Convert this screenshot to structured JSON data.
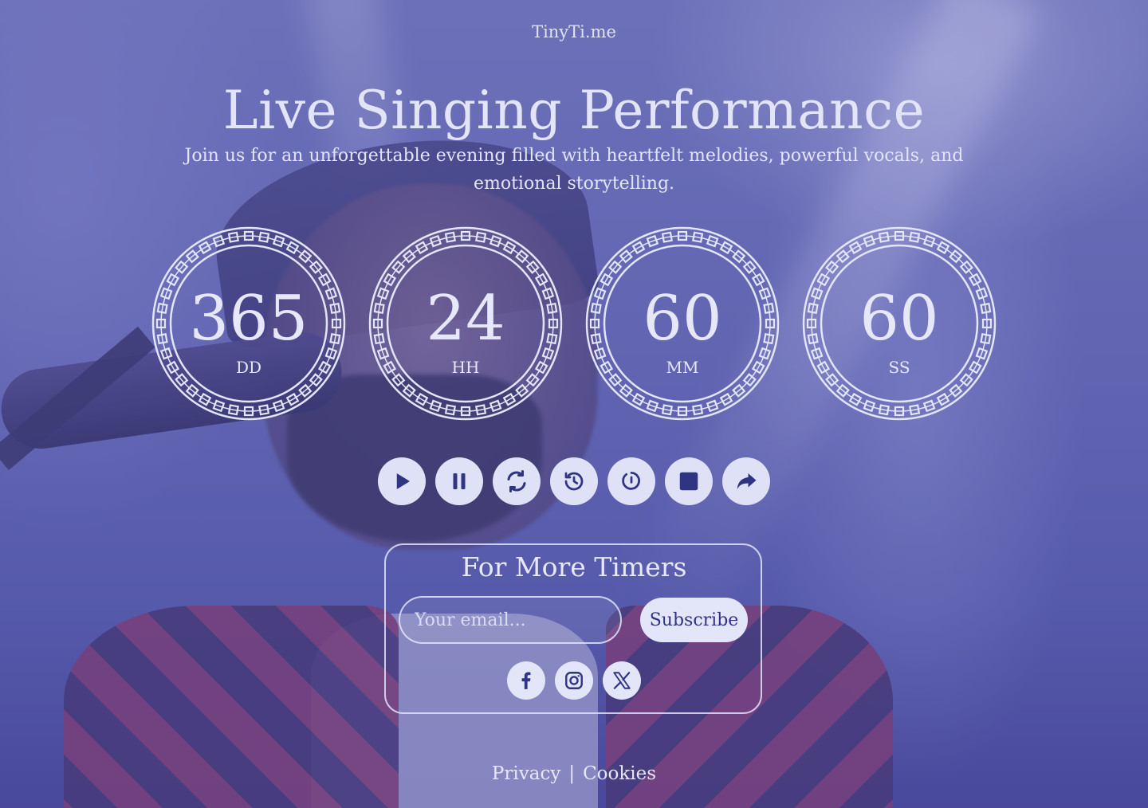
{
  "brand": "TinyTi.me",
  "event": {
    "title": "Live Singing Performance",
    "subtitle": "Join us for an unforgettable evening filled with heartfelt melodies, powerful vocals, and emotional storytelling."
  },
  "countdown": [
    {
      "value": "365",
      "label": "DD"
    },
    {
      "value": "24",
      "label": "HH"
    },
    {
      "value": "60",
      "label": "MM"
    },
    {
      "value": "60",
      "label": "SS"
    }
  ],
  "controls": [
    {
      "name": "play-icon"
    },
    {
      "name": "pause-icon"
    },
    {
      "name": "refresh-icon"
    },
    {
      "name": "history-icon"
    },
    {
      "name": "timer-reset-icon"
    },
    {
      "name": "stop-icon"
    },
    {
      "name": "share-icon"
    }
  ],
  "subscribe": {
    "title": "For More Timers",
    "email_placeholder": "Your email...",
    "button_label": "Subscribe"
  },
  "social": [
    {
      "name": "facebook-icon"
    },
    {
      "name": "instagram-icon"
    },
    {
      "name": "x-icon"
    }
  ],
  "footer": {
    "privacy": "Privacy",
    "separator": "|",
    "cookies": "Cookies"
  },
  "colors": {
    "overlay": "#585cb0",
    "icon": "#2f3582",
    "button_bg": "#dfe2f6",
    "text": "#e2e4f8"
  }
}
